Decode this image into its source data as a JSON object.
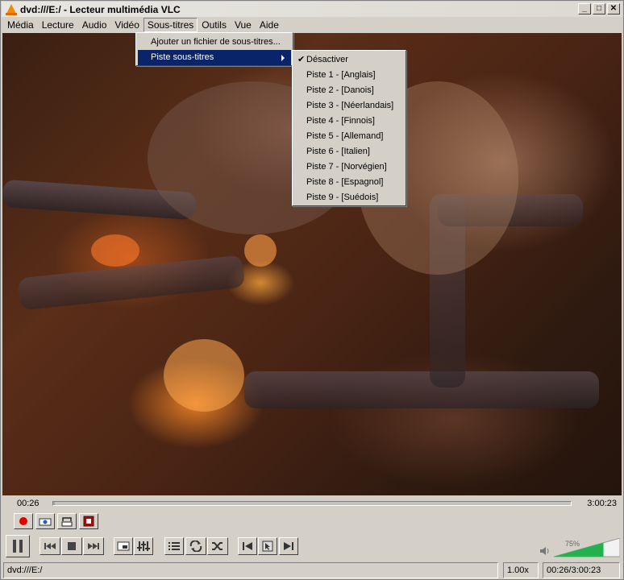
{
  "window": {
    "title": "dvd:///E:/ - Lecteur multimédia VLC"
  },
  "titlebar_buttons": {
    "minimize": "_",
    "maximize": "□",
    "close": "✕"
  },
  "menubar": {
    "items": [
      {
        "label": "Média"
      },
      {
        "label": "Lecture"
      },
      {
        "label": "Audio"
      },
      {
        "label": "Vidéo"
      },
      {
        "label": "Sous-titres"
      },
      {
        "label": "Outils"
      },
      {
        "label": "Vue"
      },
      {
        "label": "Aide"
      }
    ],
    "active": "Sous-titres"
  },
  "subtitles_menu": {
    "items": [
      {
        "label": "Ajouter un fichier de sous-titres..."
      },
      {
        "label": "Piste sous-titres"
      }
    ]
  },
  "track_submenu": {
    "items": [
      {
        "label": "Désactiver",
        "checked": true
      },
      {
        "label": "Piste 1 - [Anglais]"
      },
      {
        "label": "Piste 2 - [Danois]"
      },
      {
        "label": "Piste 3 - [Néerlandais]"
      },
      {
        "label": "Piste 4 - [Finnois]"
      },
      {
        "label": "Piste 5 - [Allemand]"
      },
      {
        "label": "Piste 6 - [Italien]"
      },
      {
        "label": "Piste 7 - [Norvégien]"
      },
      {
        "label": "Piste 8 - [Espagnol]"
      },
      {
        "label": "Piste 9 - [Suédois]"
      }
    ],
    "check_mark": "✔"
  },
  "playback": {
    "elapsed": "00:26",
    "total": "3:00:23",
    "progress_fraction": 0.0024
  },
  "volume": {
    "label": "75%",
    "level": 0.75
  },
  "statusbar": {
    "source": "dvd:///E:/",
    "speed": "1.00x",
    "time": "00:26/3:00:23"
  },
  "colors": {
    "menu_highlight": "#0a246a",
    "record": "#e00000",
    "volume_fill": "#22b14c"
  }
}
